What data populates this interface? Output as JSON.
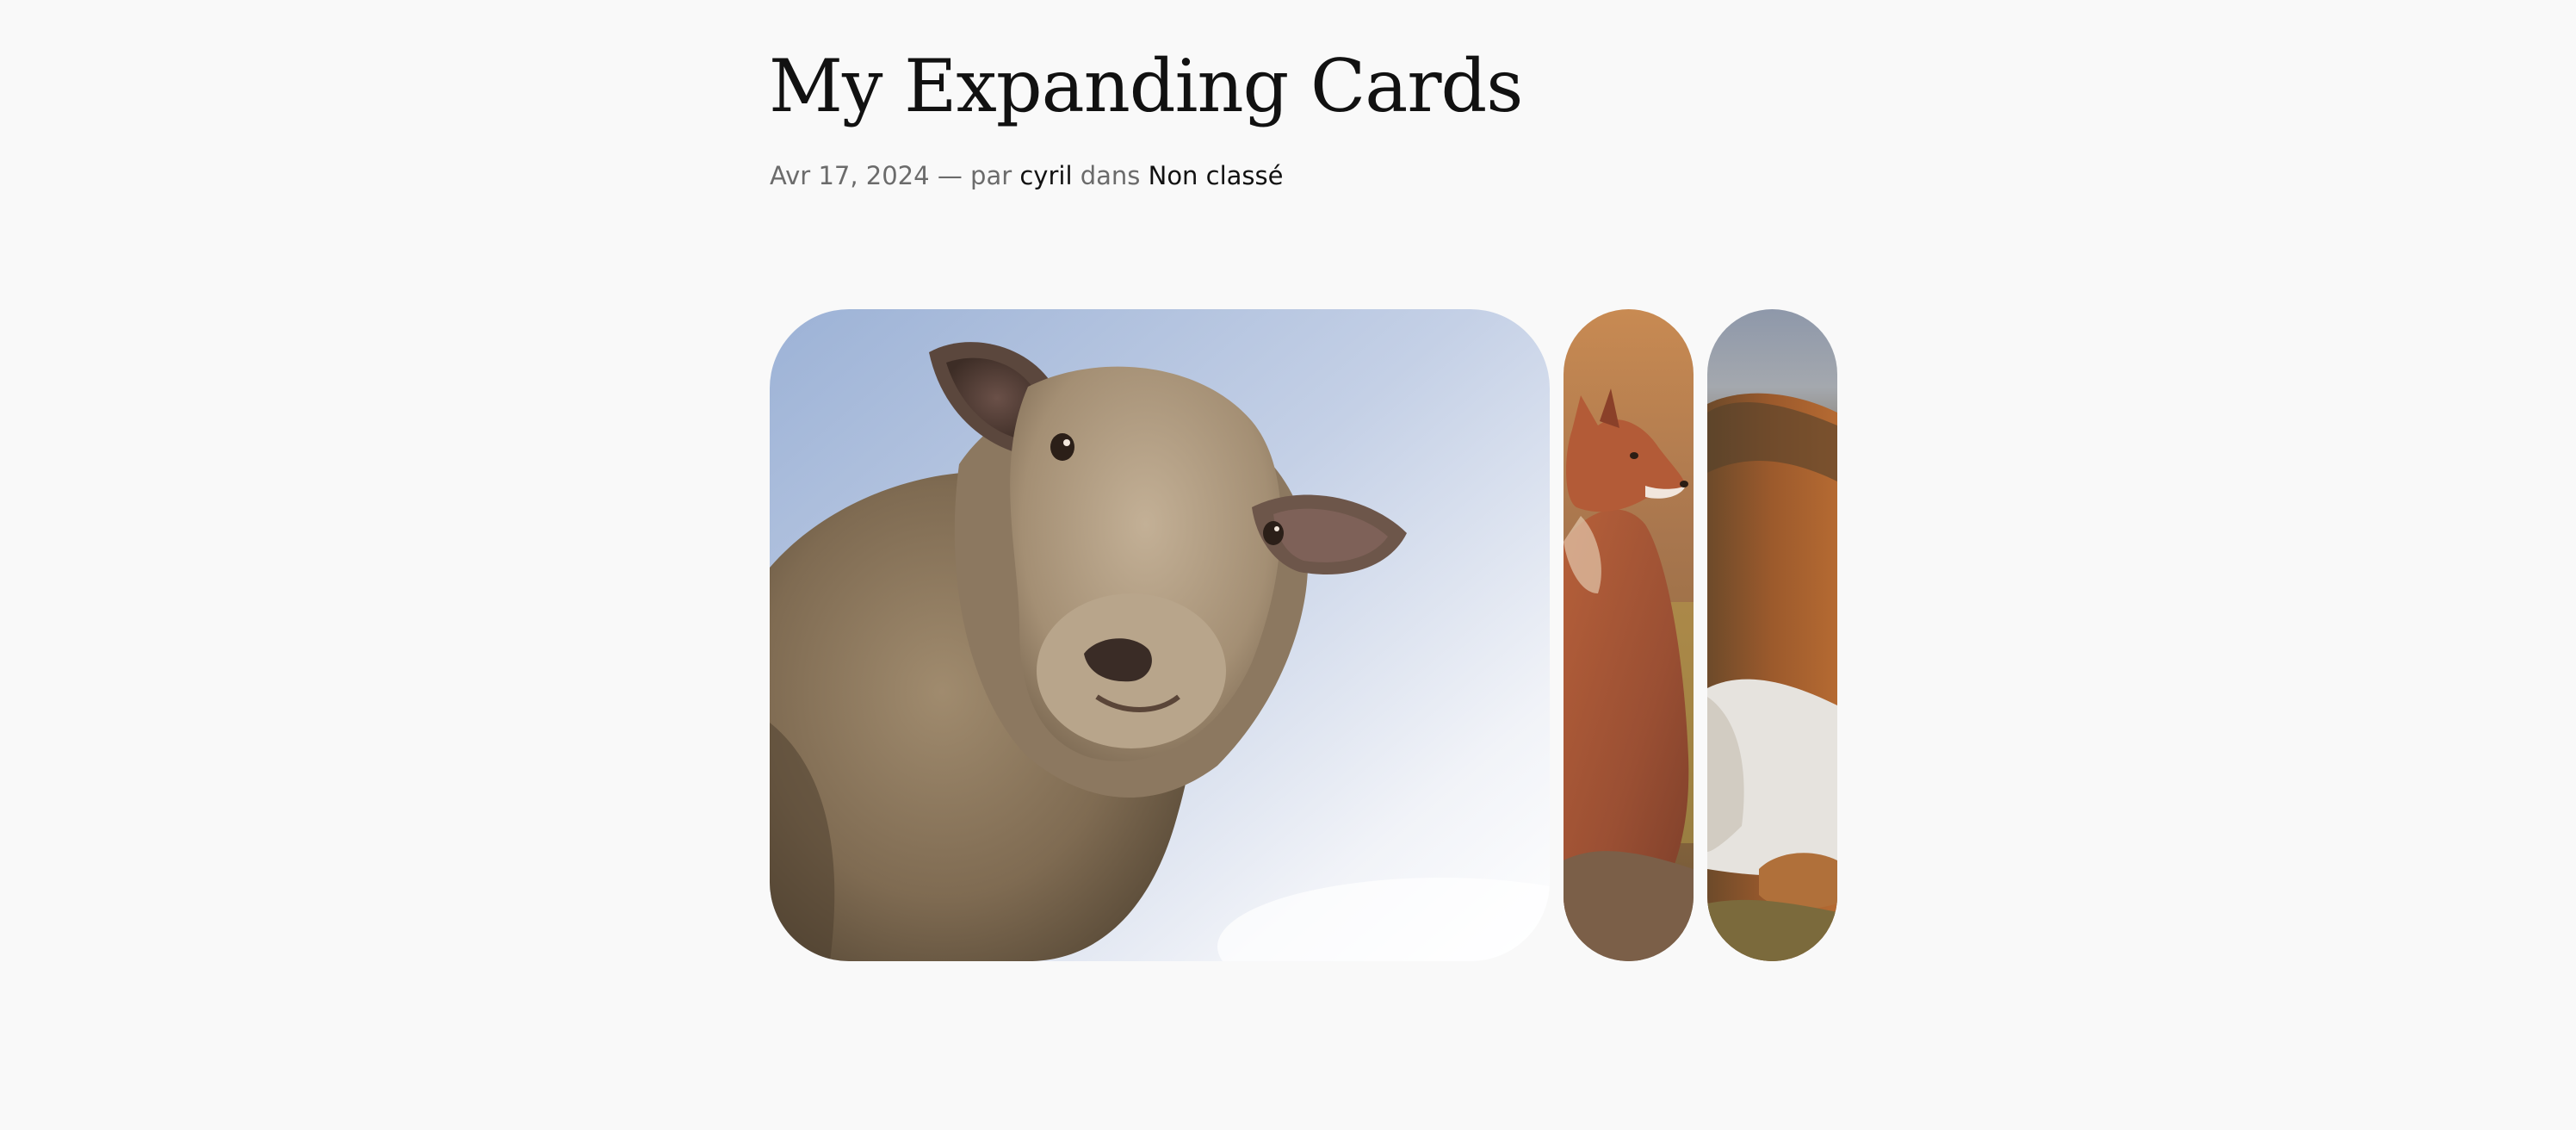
{
  "post": {
    "title": "My Expanding Cards",
    "date": "Avr 17, 2024",
    "separator": "—",
    "by_label": "par",
    "author": "cyril",
    "in_label": "dans",
    "category": "Non classé"
  },
  "cards": [
    {
      "subject": "sheep",
      "state": "expanded"
    },
    {
      "subject": "fox",
      "state": "collapsed"
    },
    {
      "subject": "squirrel",
      "state": "collapsed"
    }
  ],
  "colors": {
    "background": "#f9f9f9",
    "title": "#111111",
    "meta_text": "#6b6b6b",
    "meta_link": "#111111"
  }
}
